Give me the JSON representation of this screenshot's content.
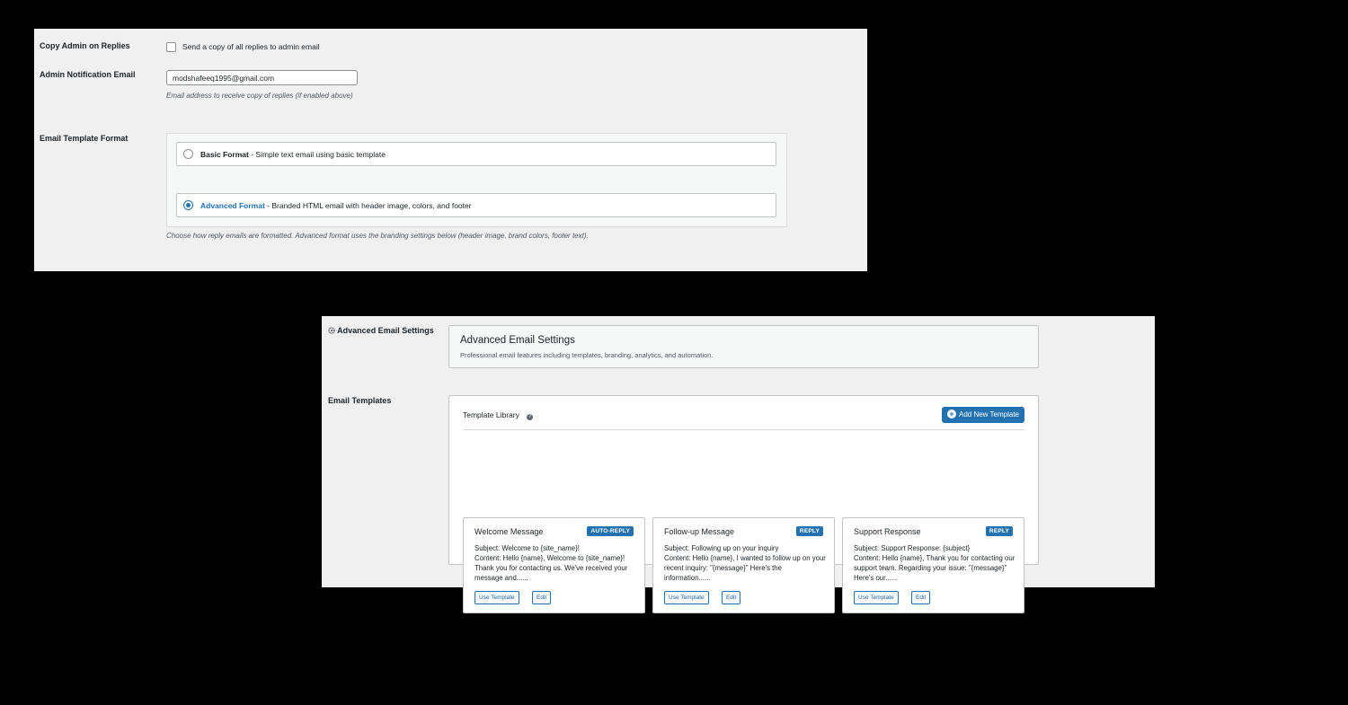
{
  "general": {
    "copy_admin_label": "Copy Admin on Replies",
    "copy_admin_checkbox_text": "Send a copy of all replies to admin email",
    "admin_email_label": "Admin Notification Email",
    "admin_email_value": "modshafeeq1995@gmail.com",
    "admin_email_desc": "Email address to receive copy of replies (if enabled above)",
    "template_format_label": "Email Template Format",
    "basic_name": "Basic Format",
    "basic_desc": " - Simple text email using basic template",
    "advanced_name": "Advanced Format",
    "advanced_desc": " - Branded HTML email with header image, colors, and footer",
    "format_desc": "Choose how reply emails are formatted. Advanced format uses the branding settings below (header image, brand colors, footer text)."
  },
  "advanced": {
    "section_label": "Advanced Email Settings",
    "icon": "gear-icon",
    "title": "Advanced Email Settings",
    "subtitle": "Professional email features including templates, branding, analytics, and automation.",
    "templates_label": "Email Templates",
    "library_title": "Template Library",
    "help_icon": "help-icon",
    "add_button": "Add New Template",
    "add_icon": "plus-circle-icon",
    "accent_color": "#2271b1",
    "templates": [
      {
        "name": "Welcome Message",
        "badge": "AUTO-REPLY",
        "subject": "Subject: Welcome to {site_name}!",
        "content": "Content: Hello {name}, Welcome to {site_name}! Thank you for contacting us. We've received your message and......",
        "use_label": "Use Template",
        "edit_label": "Edit"
      },
      {
        "name": "Follow-up Message",
        "badge": "REPLY",
        "subject": "Subject: Following up on your inquiry",
        "content": "Content: Hello {name}, I wanted to follow up on your recent inquiry: \"{message}\" Here's the information......",
        "use_label": "Use Template",
        "edit_label": "Edit"
      },
      {
        "name": "Support Response",
        "badge": "REPLY",
        "subject": "Subject: Support Response: {subject}",
        "content": "Content: Hello {name}, Thank you for contacting our support team. Regarding your issue: \"{message}\" Here's our......",
        "use_label": "Use Template",
        "edit_label": "Edit"
      }
    ]
  }
}
